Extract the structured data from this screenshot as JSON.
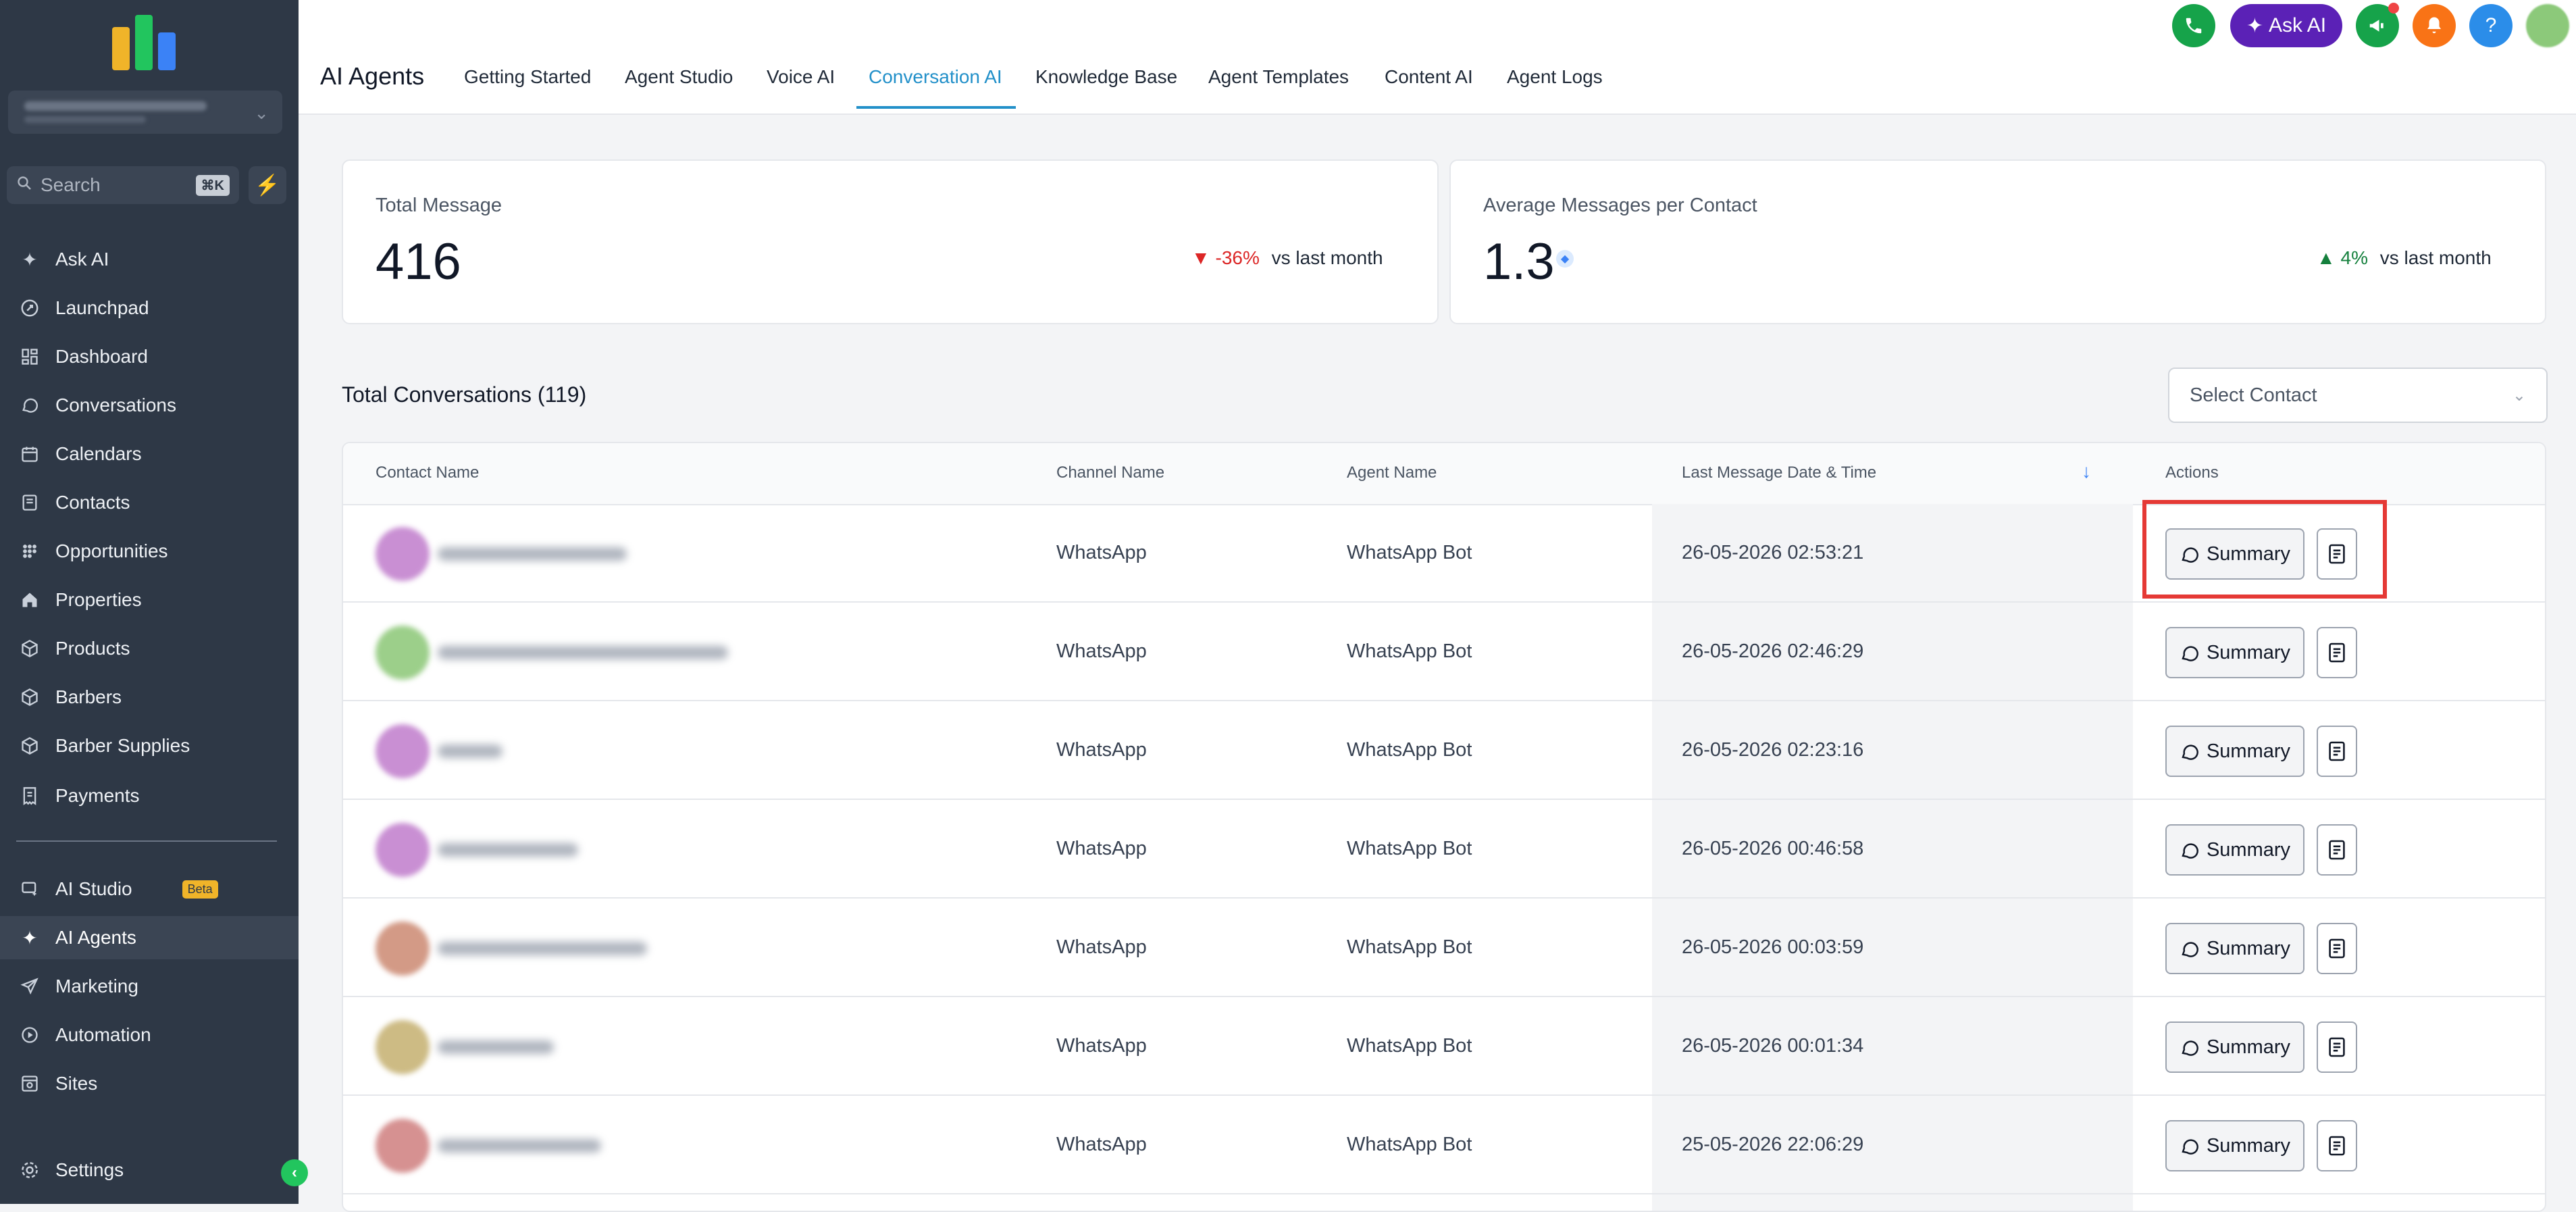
{
  "sidebar": {
    "search_placeholder": "Search",
    "search_shortcut": "⌘K",
    "items": [
      {
        "label": "Ask AI",
        "icon": "sparkle-icon"
      },
      {
        "label": "Launchpad",
        "icon": "rocket-icon"
      },
      {
        "label": "Dashboard",
        "icon": "dashboard-icon"
      },
      {
        "label": "Conversations",
        "icon": "chat-bubble-icon"
      },
      {
        "label": "Calendars",
        "icon": "calendar-icon"
      },
      {
        "label": "Contacts",
        "icon": "contacts-icon"
      },
      {
        "label": "Opportunities",
        "icon": "opportunities-icon"
      },
      {
        "label": "Properties",
        "icon": "home-icon"
      },
      {
        "label": "Products",
        "icon": "box-icon"
      },
      {
        "label": "Barbers",
        "icon": "box-icon"
      },
      {
        "label": "Barber Supplies",
        "icon": "box-icon"
      },
      {
        "label": "Payments",
        "icon": "receipt-icon"
      },
      {
        "label": "AI Studio",
        "icon": "ai-studio-icon",
        "badge": "Beta"
      },
      {
        "label": "AI Agents",
        "icon": "sparkle-icon",
        "active": true
      },
      {
        "label": "Marketing",
        "icon": "send-icon"
      },
      {
        "label": "Automation",
        "icon": "automation-icon"
      },
      {
        "label": "Sites",
        "icon": "sites-icon"
      },
      {
        "label": "Settings",
        "icon": "gear-icon"
      }
    ]
  },
  "header": {
    "title": "AI Agents",
    "tabs": [
      {
        "label": "Getting Started"
      },
      {
        "label": "Agent Studio"
      },
      {
        "label": "Voice AI"
      },
      {
        "label": "Conversation AI",
        "active": true
      },
      {
        "label": "Knowledge Base"
      },
      {
        "label": "Agent Templates"
      },
      {
        "label": "Content AI"
      },
      {
        "label": "Agent Logs"
      }
    ],
    "ask_ai_label": "Ask AI",
    "help_label": "?"
  },
  "stats": {
    "total_message": {
      "label": "Total Message",
      "value": "416",
      "change": "-36%",
      "vs": "vs last month"
    },
    "avg_messages": {
      "label": "Average Messages per Contact",
      "value": "1.3",
      "change": "4%",
      "vs": "vs last month"
    }
  },
  "conversations": {
    "title": "Total Conversations (119)",
    "select_placeholder": "Select Contact",
    "columns": [
      "Contact Name",
      "Channel Name",
      "Agent Name",
      "Last Message Date & Time",
      "Actions"
    ],
    "summary_label": "Summary",
    "rows": [
      {
        "channel": "WhatsApp",
        "agent": "WhatsApp Bot",
        "datetime": "26-05-2026 02:53:21",
        "avatar_color": "#c98fd3"
      },
      {
        "channel": "WhatsApp",
        "agent": "WhatsApp Bot",
        "datetime": "26-05-2026 02:46:29",
        "avatar_color": "#9ccf8a"
      },
      {
        "channel": "WhatsApp",
        "agent": "WhatsApp Bot",
        "datetime": "26-05-2026 02:23:16",
        "avatar_color": "#c98fd3"
      },
      {
        "channel": "WhatsApp",
        "agent": "WhatsApp Bot",
        "datetime": "26-05-2026 00:46:58",
        "avatar_color": "#c98fd3"
      },
      {
        "channel": "WhatsApp",
        "agent": "WhatsApp Bot",
        "datetime": "26-05-2026 00:03:59",
        "avatar_color": "#d39a86"
      },
      {
        "channel": "WhatsApp",
        "agent": "WhatsApp Bot",
        "datetime": "26-05-2026 00:01:34",
        "avatar_color": "#cdbb84"
      },
      {
        "channel": "WhatsApp",
        "agent": "WhatsApp Bot",
        "datetime": "25-05-2026 22:06:29",
        "avatar_color": "#d69191"
      }
    ]
  },
  "colors": {
    "sidebar_bg": "#2e3846",
    "accent": "#2290c9",
    "ask_ai": "#5b21b6",
    "highlight": "#e53935",
    "negative": "#dc2626",
    "positive": "#15803d"
  }
}
